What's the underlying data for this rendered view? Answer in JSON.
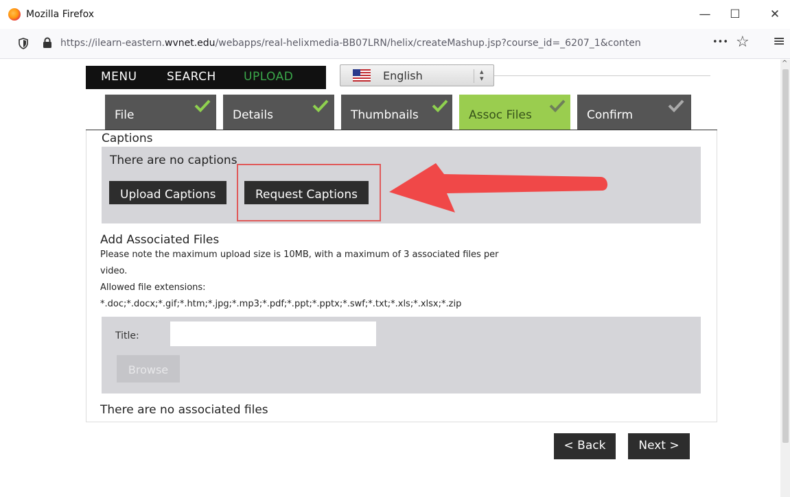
{
  "window": {
    "title": "Mozilla Firefox",
    "controls": {
      "minimize": "—",
      "maximize": "☐",
      "close": "✕"
    }
  },
  "browser": {
    "url_prefix": "https://ilearn-eastern.",
    "url_domain": "wvnet.edu",
    "url_suffix": "/webapps/real-helixmedia-BB07LRN/helix/createMashup.jsp?course_id=_6207_1&conten",
    "more_glyph": "•••",
    "star_glyph": "☆",
    "menu_glyph": "≡"
  },
  "top_menu": {
    "menu": "MENU",
    "search": "SEARCH",
    "upload": "UPLOAD"
  },
  "language": {
    "selected": "English"
  },
  "tabs": [
    {
      "label": "File",
      "check": "✔"
    },
    {
      "label": "Details",
      "check": "✔"
    },
    {
      "label": "Thumbnails",
      "check": "✔"
    },
    {
      "label": "Assoc Files",
      "check": "✔"
    },
    {
      "label": "Confirm",
      "check": "✔"
    }
  ],
  "captions": {
    "heading": "Captions",
    "empty_text": "There are no captions",
    "upload_button": "Upload Captions",
    "request_button": "Request Captions"
  },
  "assoc": {
    "heading": "Add Associated Files",
    "note_line1": "Please note the maximum upload size is 10MB, with a maximum of 3 associated files per",
    "note_line2": "video.",
    "allowed_label": "Allowed file extensions:",
    "extensions": "*.doc;*.docx;*.gif;*.htm;*.jpg;*.mp3;*.pdf;*.ppt;*.pptx;*.swf;*.txt;*.xls;*.xlsx;*.zip",
    "title_label": "Title:",
    "title_value": "",
    "browse_button": "Browse",
    "empty_text": "There are no associated files"
  },
  "nav": {
    "back": "< Back",
    "next": "Next >"
  },
  "colors": {
    "active_tab": "#9acd4f",
    "upload_link": "#3aa84a",
    "annotation_red": "#f04848"
  }
}
